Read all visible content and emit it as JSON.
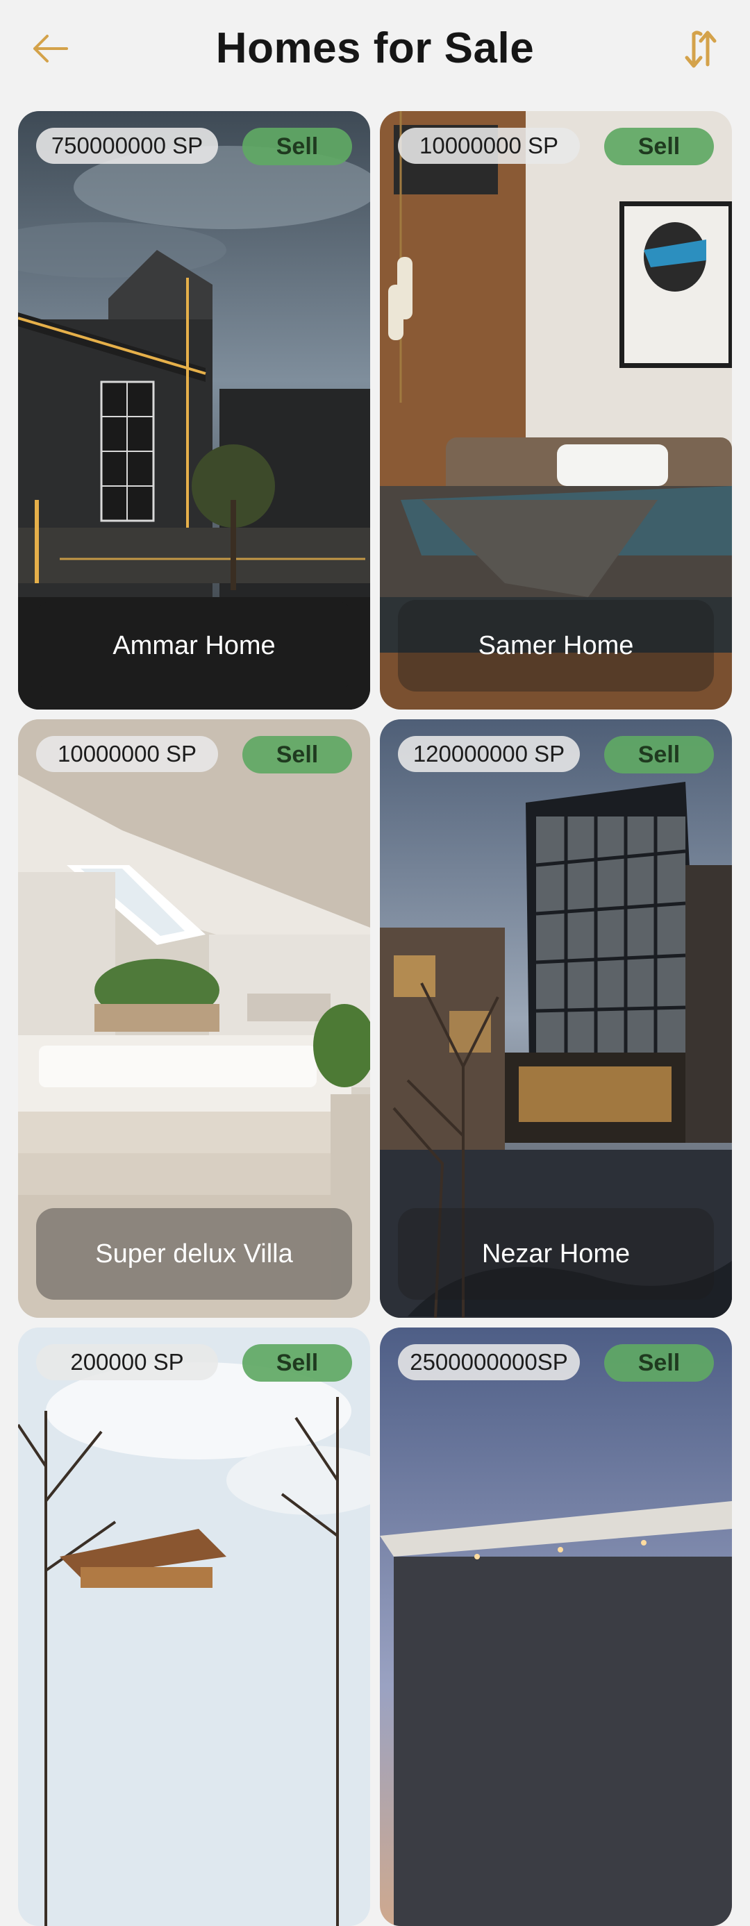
{
  "header": {
    "title": "Homes for Sale",
    "back_icon": "arrow-left-icon",
    "sort_icon": "sort-arrows-icon",
    "accent_color": "#D4A24A"
  },
  "listings": [
    {
      "price": "750000000 SP",
      "badge": "Sell",
      "name": "Ammar Home"
    },
    {
      "price": "10000000  SP",
      "badge": "Sell",
      "name": "Samer Home"
    },
    {
      "price": "10000000  SP",
      "badge": "Sell",
      "name": "Super delux Villa"
    },
    {
      "price": "120000000 SP",
      "badge": "Sell",
      "name": "Nezar Home"
    },
    {
      "price": "200000    SP",
      "badge": "Sell",
      "name": ""
    },
    {
      "price": "2500000000SP",
      "badge": "Sell",
      "name": ""
    }
  ],
  "colors": {
    "background": "#F2F2F2",
    "sell_badge": "#5FA864",
    "price_pill": "#E8E8E8"
  }
}
